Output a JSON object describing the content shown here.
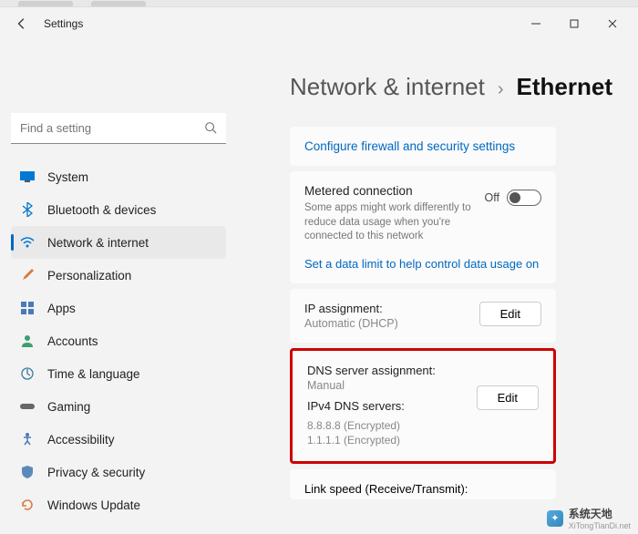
{
  "window": {
    "app_title": "Settings"
  },
  "search": {
    "placeholder": "Find a setting"
  },
  "sidebar": {
    "items": [
      {
        "label": "System"
      },
      {
        "label": "Bluetooth & devices"
      },
      {
        "label": "Network & internet"
      },
      {
        "label": "Personalization"
      },
      {
        "label": "Apps"
      },
      {
        "label": "Accounts"
      },
      {
        "label": "Time & language"
      },
      {
        "label": "Gaming"
      },
      {
        "label": "Accessibility"
      },
      {
        "label": "Privacy & security"
      },
      {
        "label": "Windows Update"
      }
    ]
  },
  "breadcrumb": {
    "parent": "Network & internet",
    "separator": "›",
    "current": "Ethernet"
  },
  "main": {
    "firewall_link": "Configure firewall and security settings",
    "metered": {
      "title": "Metered connection",
      "subtitle": "Some apps might work differently to reduce data usage when you're connected to this network",
      "toggle_state": "Off",
      "data_limit_link": "Set a data limit to help control data usage on this"
    },
    "ip": {
      "label": "IP assignment:",
      "value": "Automatic (DHCP)",
      "edit": "Edit"
    },
    "dns": {
      "label": "DNS server assignment:",
      "value": "Manual",
      "ipv4_label": "IPv4 DNS servers:",
      "server1": "8.8.8.8 (Encrypted)",
      "server2": "1.1.1.1 (Encrypted)",
      "edit": "Edit"
    },
    "linkspeed": {
      "label": "Link speed (Receive/Transmit):"
    }
  },
  "watermark": {
    "brand": "系统天地",
    "url": "XiTongTianDi.net"
  }
}
